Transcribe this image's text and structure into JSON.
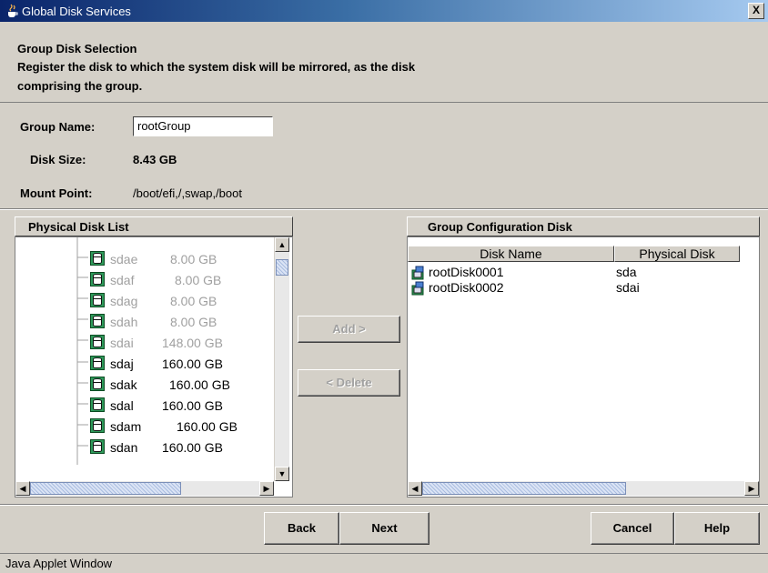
{
  "window": {
    "title": "Global Disk Services",
    "close_label": "X"
  },
  "header": {
    "title": "Group Disk Selection",
    "description_line1": "Register the disk to which the system disk will be mirrored, as the disk",
    "description_line2": "comprising the group."
  },
  "form": {
    "group_name_label": "Group Name:",
    "group_name_value": "rootGroup",
    "disk_size_label": "Disk Size:",
    "disk_size_value": "8.43 GB",
    "mount_point_label": "Mount Point:",
    "mount_point_value": "/boot/efi,/,swap,/boot"
  },
  "physical_disk_list": {
    "header": "Physical Disk List",
    "items": [
      {
        "name": "sdae",
        "size": "8.00 GB",
        "enabled": false
      },
      {
        "name": "sdaf",
        "size": "8.00 GB",
        "enabled": false
      },
      {
        "name": "sdag",
        "size": "8.00 GB",
        "enabled": false
      },
      {
        "name": "sdah",
        "size": "8.00 GB",
        "enabled": false
      },
      {
        "name": "sdai",
        "size": "148.00 GB",
        "enabled": false
      },
      {
        "name": "sdaj",
        "size": "160.00 GB",
        "enabled": true
      },
      {
        "name": "sdak",
        "size": "160.00 GB",
        "enabled": true
      },
      {
        "name": "sdal",
        "size": "160.00 GB",
        "enabled": true
      },
      {
        "name": "sdam",
        "size": "160.00 GB",
        "enabled": true
      },
      {
        "name": "sdan",
        "size": "160.00 GB",
        "enabled": true
      }
    ]
  },
  "actions": {
    "add_label": "Add >",
    "delete_label": "< Delete"
  },
  "group_config": {
    "header": "Group Configuration Disk",
    "columns": [
      "Disk Name",
      "Physical Disk"
    ],
    "rows": [
      {
        "disk_name": "rootDisk0001",
        "physical_disk": "sda"
      },
      {
        "disk_name": "rootDisk0002",
        "physical_disk": "sdai"
      }
    ]
  },
  "footer": {
    "back": "Back",
    "next": "Next",
    "cancel": "Cancel",
    "help": "Help"
  },
  "status": {
    "text": "Java Applet Window"
  },
  "icons": {
    "title": "java-cup-icon",
    "list_item": "disk-icon",
    "group_item": "group-disk-icon"
  },
  "colors": {
    "title_bar_start": "#0a246a",
    "title_bar_end": "#a6caf0",
    "disk_icon": "#2e9a5a",
    "disabled_text": "#a0a0a0"
  }
}
